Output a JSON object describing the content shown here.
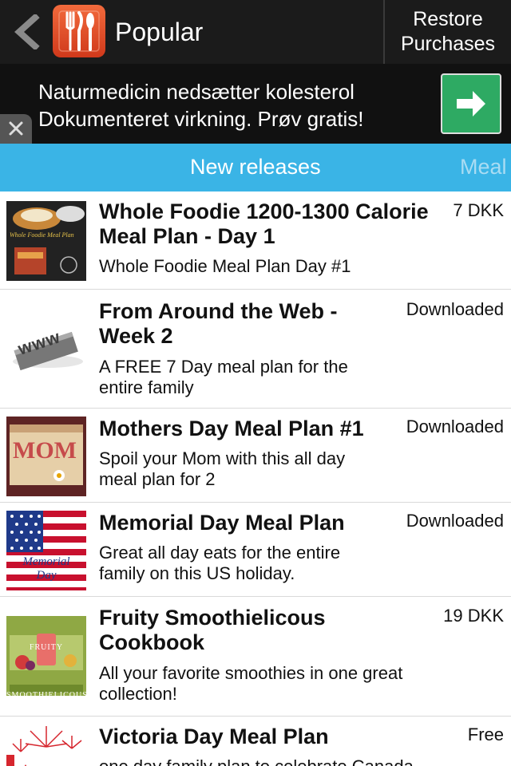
{
  "header": {
    "title": "Popular",
    "restore": "Restore\nPurchases"
  },
  "ad": {
    "line1": "Naturmedicin nedsætter kolesterol",
    "line2": "Dokumenteret virkning. Prøv gratis!"
  },
  "tabs": [
    {
      "label": "New releases"
    },
    {
      "label": "Meal"
    }
  ],
  "items": [
    {
      "title": "Whole Foodie 1200-1300 Calorie Meal Plan - Day 1",
      "desc": "Whole Foodie Meal Plan Day #1",
      "price": "7 DKK",
      "thumb_text": "Whole Foodie Meal Plan"
    },
    {
      "title": "From Around the Web - Week 2",
      "desc": "A FREE 7 Day meal plan for the entire family",
      "price": "Downloaded",
      "thumb_text": "www"
    },
    {
      "title": "Mothers Day Meal Plan #1",
      "desc": "Spoil your Mom with this all day meal plan for 2",
      "price": "Downloaded",
      "thumb_text": "MOM"
    },
    {
      "title": "Memorial Day Meal Plan",
      "desc": "Great all day eats for the entire family on this US holiday.",
      "price": "Downloaded",
      "thumb_text": "Memorial Day"
    },
    {
      "title": "Fruity Smoothielicous Cookbook",
      "desc": "All your favorite smoothies in one great collection!",
      "price": "19 DKK",
      "thumb_text": "FRUITY SMOOTHIELICOUS"
    },
    {
      "title": "Victoria Day Meal Plan",
      "desc": "one day family plan to celebrate Canada",
      "price": "Free",
      "thumb_text": ""
    }
  ],
  "colors": {
    "topbar": "#1b1b1b",
    "tabbar": "#3ab4e6",
    "ad_button": "#2eaa63",
    "logo": "#e0492a"
  }
}
